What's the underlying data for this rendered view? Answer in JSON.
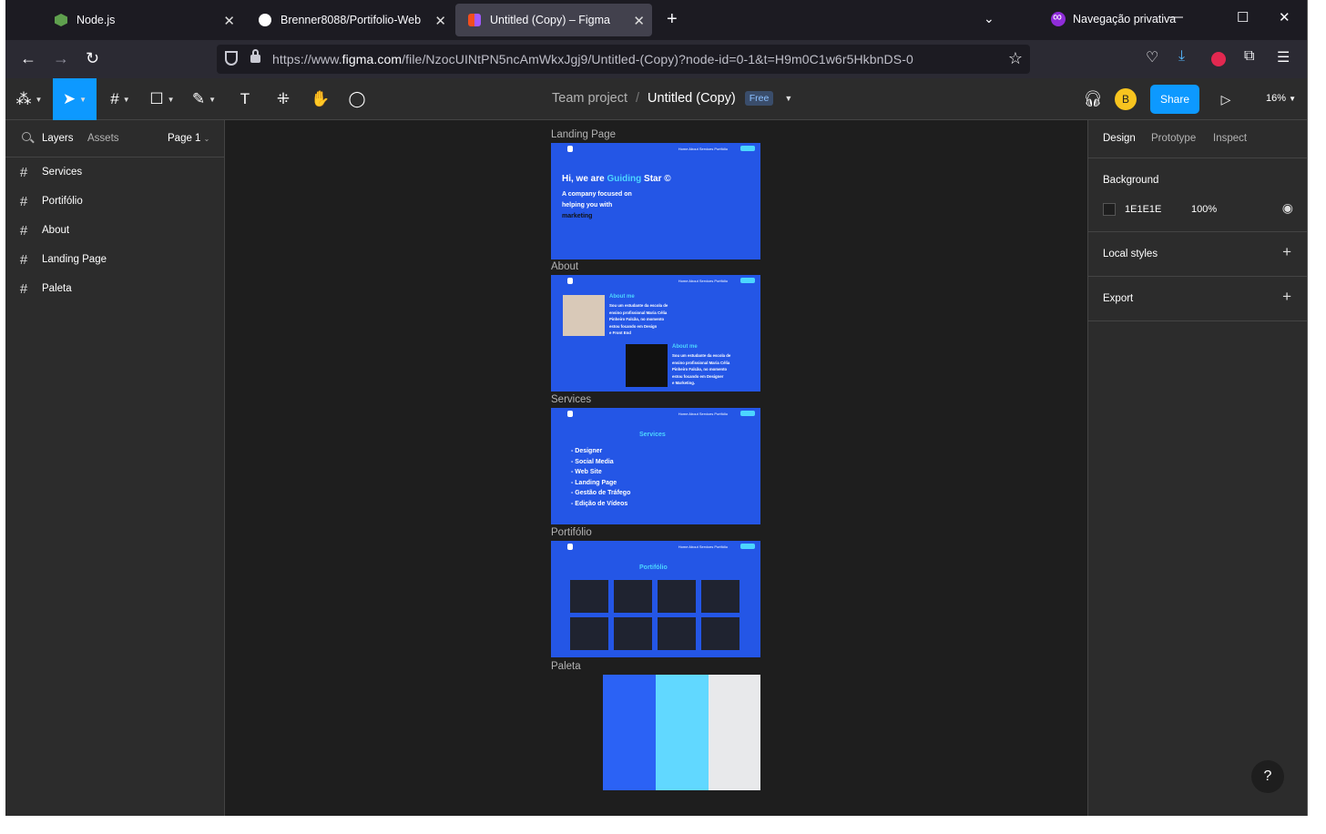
{
  "browser": {
    "tabs": [
      {
        "title": "Node.js",
        "color": "#5fa04e"
      },
      {
        "title": "Brenner8088/Portifolio-Web",
        "color": "#ffffff"
      },
      {
        "title": "Untitled (Copy) – Figma",
        "color": "#f24e1e"
      }
    ],
    "private_label": "Navegação privativa",
    "url_prefix": "https://www.",
    "url_domain": "figma.com",
    "url_path": "/file/NzocUINtPN5ncAmWkxJgj9/Untitled-(Copy)?node-id=0-1&t=H9m0C1w6r5HkbnDS-0"
  },
  "figma": {
    "team": "Team project",
    "file": "Untitled (Copy)",
    "plan_badge": "Free",
    "avatar": "B",
    "share_label": "Share",
    "zoom": "16%",
    "left": {
      "tab_layers": "Layers",
      "tab_assets": "Assets",
      "page": "Page 1",
      "layers": [
        "Services",
        "Portifólio",
        "About",
        "Landing Page",
        "Paleta"
      ]
    },
    "right": {
      "tab_design": "Design",
      "tab_prototype": "Prototype",
      "tab_inspect": "Inspect",
      "background_label": "Background",
      "bg_hex": "1E1E1E",
      "bg_opacity": "100%",
      "local_styles": "Local styles",
      "export": "Export"
    },
    "help": "?"
  },
  "canvas": {
    "frames": {
      "landing": {
        "label": "Landing Page",
        "headline_pre": "Hi, we are ",
        "headline_accent": "Guiding",
        "headline_post": " Star ©",
        "sub1": "A company focused on",
        "sub2": "helping you with",
        "sub3": "marketing"
      },
      "about": {
        "label": "About",
        "title1": "About me",
        "text1": [
          "Sou um estudante da escola de",
          "ensino profissional Maria Célia",
          "Pinheiro Falcão, no momento",
          "estou focando em Design",
          "e Front End"
        ],
        "title2": "About me",
        "text2": [
          "Sou um estudante da escola de",
          "ensino profissional Maria Célia",
          "Pinheiro Falcão, no momento",
          "estou focando em Designer",
          "e Marketing."
        ]
      },
      "services": {
        "label": "Services",
        "title": "Services",
        "items": [
          "- Designer",
          "- Social Media",
          "- Web Site",
          "- Landing Page",
          "- Gestão de Tráfego",
          "- Edição de Vídeos"
        ]
      },
      "portfolio": {
        "label": "Portifólio",
        "title": "Portifólio"
      },
      "paleta": {
        "label": "Paleta",
        "colors": [
          "#2b62f5",
          "#61d8ff",
          "#e8e9eb"
        ]
      }
    },
    "nav_links": "Home  About  Services  Portfólio"
  }
}
